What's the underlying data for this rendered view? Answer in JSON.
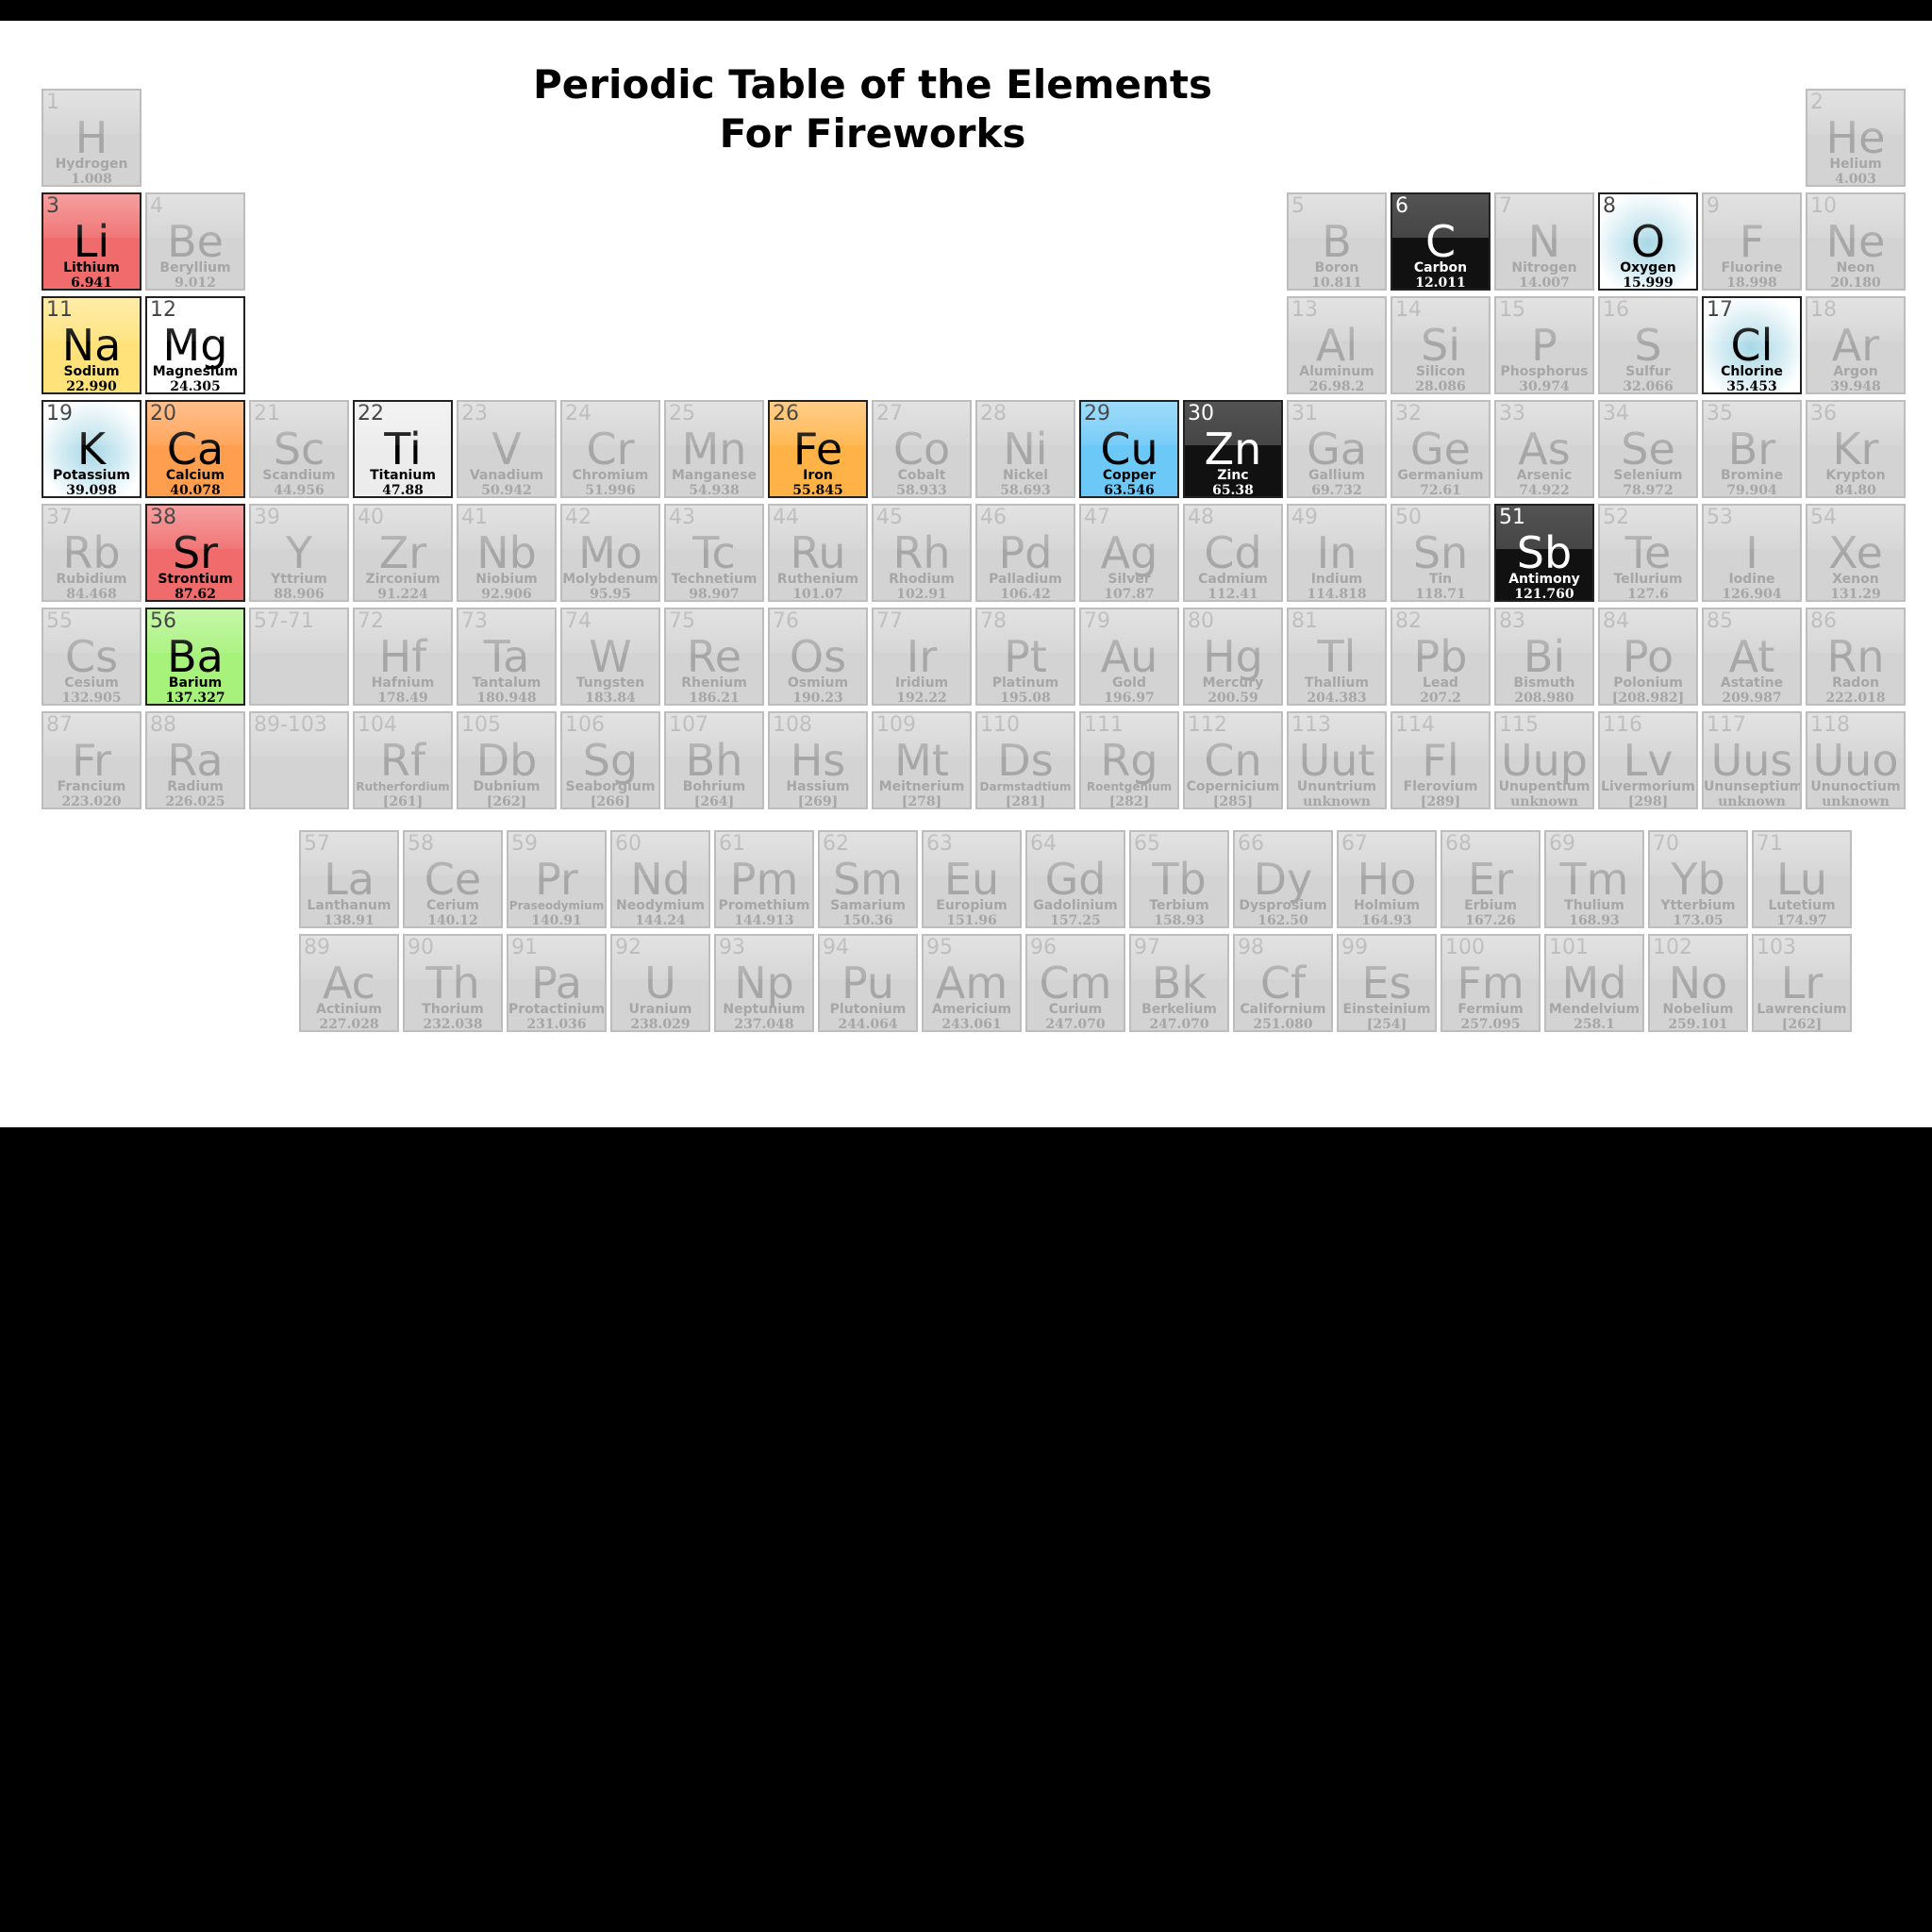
{
  "title": {
    "line1": "Periodic Table of the Elements",
    "line2": "For Fireworks"
  },
  "colors": {
    "inactive_bg": "#d3d3d3",
    "inactive_text": "#a6a6a6"
  },
  "main_table": [
    {
      "n": "1",
      "s": "H",
      "name": "Hydrogen",
      "w": "1.008",
      "row": 1,
      "col": 1
    },
    {
      "n": "2",
      "s": "He",
      "name": "Helium",
      "w": "4.003",
      "row": 1,
      "col": 18
    },
    {
      "n": "3",
      "s": "Li",
      "name": "Lithium",
      "w": "6.941",
      "row": 2,
      "col": 1,
      "color": "#f06b6b",
      "hl": "light"
    },
    {
      "n": "4",
      "s": "Be",
      "name": "Beryllium",
      "w": "9.012",
      "row": 2,
      "col": 2
    },
    {
      "n": "5",
      "s": "B",
      "name": "Boron",
      "w": "10.811",
      "row": 2,
      "col": 13
    },
    {
      "n": "6",
      "s": "C",
      "name": "Carbon",
      "w": "12.011",
      "row": 2,
      "col": 14,
      "color": "#111111",
      "hl": "dark"
    },
    {
      "n": "7",
      "s": "N",
      "name": "Nitrogen",
      "w": "14.007",
      "row": 2,
      "col": 15
    },
    {
      "n": "8",
      "s": "O",
      "name": "Oxygen",
      "w": "15.999",
      "row": 2,
      "col": 16,
      "color": "radial",
      "hl": "light"
    },
    {
      "n": "9",
      "s": "F",
      "name": "Fluorine",
      "w": "18.998",
      "row": 2,
      "col": 17
    },
    {
      "n": "10",
      "s": "Ne",
      "name": "Neon",
      "w": "20.180",
      "row": 2,
      "col": 18
    },
    {
      "n": "11",
      "s": "Na",
      "name": "Sodium",
      "w": "22.990",
      "row": 3,
      "col": 1,
      "color": "#ffe27a",
      "hl": "light"
    },
    {
      "n": "12",
      "s": "Mg",
      "name": "Magnesium",
      "w": "24.305",
      "row": 3,
      "col": 2,
      "color": "#ffffff",
      "hl": "light"
    },
    {
      "n": "13",
      "s": "Al",
      "name": "Aluminum",
      "w": "26.98.2",
      "row": 3,
      "col": 13
    },
    {
      "n": "14",
      "s": "Si",
      "name": "Silicon",
      "w": "28.086",
      "row": 3,
      "col": 14
    },
    {
      "n": "15",
      "s": "P",
      "name": "Phosphorus",
      "w": "30.974",
      "row": 3,
      "col": 15
    },
    {
      "n": "16",
      "s": "S",
      "name": "Sulfur",
      "w": "32.066",
      "row": 3,
      "col": 16
    },
    {
      "n": "17",
      "s": "Cl",
      "name": "Chlorine",
      "w": "35.453",
      "row": 3,
      "col": 17,
      "color": "radial",
      "hl": "light"
    },
    {
      "n": "18",
      "s": "Ar",
      "name": "Argon",
      "w": "39.948",
      "row": 3,
      "col": 18
    },
    {
      "n": "19",
      "s": "K",
      "name": "Potassium",
      "w": "39.098",
      "row": 4,
      "col": 1,
      "color": "radial",
      "hl": "light"
    },
    {
      "n": "20",
      "s": "Ca",
      "name": "Calcium",
      "w": "40.078",
      "row": 4,
      "col": 2,
      "color": "#ff9e4f",
      "hl": "light"
    },
    {
      "n": "21",
      "s": "Sc",
      "name": "Scandium",
      "w": "44.956",
      "row": 4,
      "col": 3
    },
    {
      "n": "22",
      "s": "Ti",
      "name": "Titanium",
      "w": "47.88",
      "row": 4,
      "col": 4,
      "color": "#ececec",
      "hl": "light"
    },
    {
      "n": "23",
      "s": "V",
      "name": "Vanadium",
      "w": "50.942",
      "row": 4,
      "col": 5
    },
    {
      "n": "24",
      "s": "Cr",
      "name": "Chromium",
      "w": "51.996",
      "row": 4,
      "col": 6
    },
    {
      "n": "25",
      "s": "Mn",
      "name": "Manganese",
      "w": "54.938",
      "row": 4,
      "col": 7
    },
    {
      "n": "26",
      "s": "Fe",
      "name": "Iron",
      "w": "55.845",
      "row": 4,
      "col": 8,
      "color": "#ffb347",
      "hl": "light"
    },
    {
      "n": "27",
      "s": "Co",
      "name": "Cobalt",
      "w": "58.933",
      "row": 4,
      "col": 9
    },
    {
      "n": "28",
      "s": "Ni",
      "name": "Nickel",
      "w": "58.693",
      "row": 4,
      "col": 10
    },
    {
      "n": "29",
      "s": "Cu",
      "name": "Copper",
      "w": "63.546",
      "row": 4,
      "col": 11,
      "color": "#6cc8f7",
      "hl": "light"
    },
    {
      "n": "30",
      "s": "Zn",
      "name": "Zinc",
      "w": "65.38",
      "row": 4,
      "col": 12,
      "color": "#111111",
      "hl": "dark"
    },
    {
      "n": "31",
      "s": "Ga",
      "name": "Gallium",
      "w": "69.732",
      "row": 4,
      "col": 13
    },
    {
      "n": "32",
      "s": "Ge",
      "name": "Germanium",
      "w": "72.61",
      "row": 4,
      "col": 14
    },
    {
      "n": "33",
      "s": "As",
      "name": "Arsenic",
      "w": "74.922",
      "row": 4,
      "col": 15
    },
    {
      "n": "34",
      "s": "Se",
      "name": "Selenium",
      "w": "78.972",
      "row": 4,
      "col": 16
    },
    {
      "n": "35",
      "s": "Br",
      "name": "Bromine",
      "w": "79.904",
      "row": 4,
      "col": 17
    },
    {
      "n": "36",
      "s": "Kr",
      "name": "Krypton",
      "w": "84.80",
      "row": 4,
      "col": 18
    },
    {
      "n": "37",
      "s": "Rb",
      "name": "Rubidium",
      "w": "84.468",
      "row": 5,
      "col": 1
    },
    {
      "n": "38",
      "s": "Sr",
      "name": "Strontium",
      "w": "87.62",
      "row": 5,
      "col": 2,
      "color": "#f06b6b",
      "hl": "light"
    },
    {
      "n": "39",
      "s": "Y",
      "name": "Yttrium",
      "w": "88.906",
      "row": 5,
      "col": 3
    },
    {
      "n": "40",
      "s": "Zr",
      "name": "Zirconium",
      "w": "91.224",
      "row": 5,
      "col": 4
    },
    {
      "n": "41",
      "s": "Nb",
      "name": "Niobium",
      "w": "92.906",
      "row": 5,
      "col": 5
    },
    {
      "n": "42",
      "s": "Mo",
      "name": "Molybdenum",
      "w": "95.95",
      "row": 5,
      "col": 6
    },
    {
      "n": "43",
      "s": "Tc",
      "name": "Technetium",
      "w": "98.907",
      "row": 5,
      "col": 7
    },
    {
      "n": "44",
      "s": "Ru",
      "name": "Ruthenium",
      "w": "101.07",
      "row": 5,
      "col": 8
    },
    {
      "n": "45",
      "s": "Rh",
      "name": "Rhodium",
      "w": "102.91",
      "row": 5,
      "col": 9
    },
    {
      "n": "46",
      "s": "Pd",
      "name": "Palladium",
      "w": "106.42",
      "row": 5,
      "col": 10
    },
    {
      "n": "47",
      "s": "Ag",
      "name": "Silver",
      "w": "107.87",
      "row": 5,
      "col": 11
    },
    {
      "n": "48",
      "s": "Cd",
      "name": "Cadmium",
      "w": "112.41",
      "row": 5,
      "col": 12
    },
    {
      "n": "49",
      "s": "In",
      "name": "Indium",
      "w": "114.818",
      "row": 5,
      "col": 13
    },
    {
      "n": "50",
      "s": "Sn",
      "name": "Tin",
      "w": "118.71",
      "row": 5,
      "col": 14
    },
    {
      "n": "51",
      "s": "Sb",
      "name": "Antimony",
      "w": "121.760",
      "row": 5,
      "col": 15,
      "color": "#111111",
      "hl": "dark"
    },
    {
      "n": "52",
      "s": "Te",
      "name": "Tellurium",
      "w": "127.6",
      "row": 5,
      "col": 16
    },
    {
      "n": "53",
      "s": "I",
      "name": "Iodine",
      "w": "126.904",
      "row": 5,
      "col": 17
    },
    {
      "n": "54",
      "s": "Xe",
      "name": "Xenon",
      "w": "131.29",
      "row": 5,
      "col": 18
    },
    {
      "n": "55",
      "s": "Cs",
      "name": "Cesium",
      "w": "132.905",
      "row": 6,
      "col": 1
    },
    {
      "n": "56",
      "s": "Ba",
      "name": "Barium",
      "w": "137.327",
      "row": 6,
      "col": 2,
      "color": "#a6f27a",
      "hl": "light"
    },
    {
      "n": "57-71",
      "s": "",
      "name": "",
      "w": "",
      "row": 6,
      "col": 3
    },
    {
      "n": "72",
      "s": "Hf",
      "name": "Hafnium",
      "w": "178.49",
      "row": 6,
      "col": 4
    },
    {
      "n": "73",
      "s": "Ta",
      "name": "Tantalum",
      "w": "180.948",
      "row": 6,
      "col": 5
    },
    {
      "n": "74",
      "s": "W",
      "name": "Tungsten",
      "w": "183.84",
      "row": 6,
      "col": 6
    },
    {
      "n": "75",
      "s": "Re",
      "name": "Rhenium",
      "w": "186.21",
      "row": 6,
      "col": 7
    },
    {
      "n": "76",
      "s": "Os",
      "name": "Osmium",
      "w": "190.23",
      "row": 6,
      "col": 8
    },
    {
      "n": "77",
      "s": "Ir",
      "name": "Iridium",
      "w": "192.22",
      "row": 6,
      "col": 9
    },
    {
      "n": "78",
      "s": "Pt",
      "name": "Platinum",
      "w": "195.08",
      "row": 6,
      "col": 10
    },
    {
      "n": "79",
      "s": "Au",
      "name": "Gold",
      "w": "196.97",
      "row": 6,
      "col": 11
    },
    {
      "n": "80",
      "s": "Hg",
      "name": "Mercury",
      "w": "200.59",
      "row": 6,
      "col": 12
    },
    {
      "n": "81",
      "s": "Tl",
      "name": "Thallium",
      "w": "204.383",
      "row": 6,
      "col": 13
    },
    {
      "n": "82",
      "s": "Pb",
      "name": "Lead",
      "w": "207.2",
      "row": 6,
      "col": 14
    },
    {
      "n": "83",
      "s": "Bi",
      "name": "Bismuth",
      "w": "208.980",
      "row": 6,
      "col": 15
    },
    {
      "n": "84",
      "s": "Po",
      "name": "Polonium",
      "w": "[208.982]",
      "row": 6,
      "col": 16
    },
    {
      "n": "85",
      "s": "At",
      "name": "Astatine",
      "w": "209.987",
      "row": 6,
      "col": 17
    },
    {
      "n": "86",
      "s": "Rn",
      "name": "Radon",
      "w": "222.018",
      "row": 6,
      "col": 18
    },
    {
      "n": "87",
      "s": "Fr",
      "name": "Francium",
      "w": "223.020",
      "row": 7,
      "col": 1
    },
    {
      "n": "88",
      "s": "Ra",
      "name": "Radium",
      "w": "226.025",
      "row": 7,
      "col": 2
    },
    {
      "n": "89-103",
      "s": "",
      "name": "",
      "w": "",
      "row": 7,
      "col": 3
    },
    {
      "n": "104",
      "s": "Rf",
      "name": "Rutherfordium",
      "w": "[261]",
      "row": 7,
      "col": 4,
      "small": true
    },
    {
      "n": "105",
      "s": "Db",
      "name": "Dubnium",
      "w": "[262]",
      "row": 7,
      "col": 5
    },
    {
      "n": "106",
      "s": "Sg",
      "name": "Seaborgium",
      "w": "[266]",
      "row": 7,
      "col": 6
    },
    {
      "n": "107",
      "s": "Bh",
      "name": "Bohrium",
      "w": "[264]",
      "row": 7,
      "col": 7
    },
    {
      "n": "108",
      "s": "Hs",
      "name": "Hassium",
      "w": "[269]",
      "row": 7,
      "col": 8
    },
    {
      "n": "109",
      "s": "Mt",
      "name": "Meitnerium",
      "w": "[278]",
      "row": 7,
      "col": 9
    },
    {
      "n": "110",
      "s": "Ds",
      "name": "Darmstadtium",
      "w": "[281]",
      "row": 7,
      "col": 10,
      "small": true
    },
    {
      "n": "111",
      "s": "Rg",
      "name": "Roentgenium",
      "w": "[282]",
      "row": 7,
      "col": 11,
      "small": true
    },
    {
      "n": "112",
      "s": "Cn",
      "name": "Copernicium",
      "w": "[285]",
      "row": 7,
      "col": 12
    },
    {
      "n": "113",
      "s": "Uut",
      "name": "Ununtrium",
      "w": "unknown",
      "row": 7,
      "col": 13
    },
    {
      "n": "114",
      "s": "Fl",
      "name": "Flerovium",
      "w": "[289]",
      "row": 7,
      "col": 14
    },
    {
      "n": "115",
      "s": "Uup",
      "name": "Unupentium",
      "w": "unknown",
      "row": 7,
      "col": 15
    },
    {
      "n": "116",
      "s": "Lv",
      "name": "Livermorium",
      "w": "[298]",
      "row": 7,
      "col": 16
    },
    {
      "n": "117",
      "s": "Uus",
      "name": "Ununseptium",
      "w": "unknown",
      "row": 7,
      "col": 17
    },
    {
      "n": "118",
      "s": "Uuo",
      "name": "Ununoctium",
      "w": "unknown",
      "row": 7,
      "col": 18
    }
  ],
  "lanthanides": [
    {
      "n": "57",
      "s": "La",
      "name": "Lanthanum",
      "w": "138.91"
    },
    {
      "n": "58",
      "s": "Ce",
      "name": "Cerium",
      "w": "140.12"
    },
    {
      "n": "59",
      "s": "Pr",
      "name": "Praseodymium",
      "w": "140.91",
      "small": true
    },
    {
      "n": "60",
      "s": "Nd",
      "name": "Neodymium",
      "w": "144.24"
    },
    {
      "n": "61",
      "s": "Pm",
      "name": "Promethium",
      "w": "144.913"
    },
    {
      "n": "62",
      "s": "Sm",
      "name": "Samarium",
      "w": "150.36"
    },
    {
      "n": "63",
      "s": "Eu",
      "name": "Europium",
      "w": "151.96"
    },
    {
      "n": "64",
      "s": "Gd",
      "name": "Gadolinium",
      "w": "157.25"
    },
    {
      "n": "65",
      "s": "Tb",
      "name": "Terbium",
      "w": "158.93"
    },
    {
      "n": "66",
      "s": "Dy",
      "name": "Dysprosium",
      "w": "162.50"
    },
    {
      "n": "67",
      "s": "Ho",
      "name": "Holmium",
      "w": "164.93"
    },
    {
      "n": "68",
      "s": "Er",
      "name": "Erbium",
      "w": "167.26"
    },
    {
      "n": "69",
      "s": "Tm",
      "name": "Thulium",
      "w": "168.93"
    },
    {
      "n": "70",
      "s": "Yb",
      "name": "Ytterbium",
      "w": "173.05"
    },
    {
      "n": "71",
      "s": "Lu",
      "name": "Lutetium",
      "w": "174.97"
    }
  ],
  "actinides": [
    {
      "n": "89",
      "s": "Ac",
      "name": "Actinium",
      "w": "227.028"
    },
    {
      "n": "90",
      "s": "Th",
      "name": "Thorium",
      "w": "232.038"
    },
    {
      "n": "91",
      "s": "Pa",
      "name": "Protactinium",
      "w": "231.036"
    },
    {
      "n": "92",
      "s": "U",
      "name": "Uranium",
      "w": "238.029"
    },
    {
      "n": "93",
      "s": "Np",
      "name": "Neptunium",
      "w": "237.048"
    },
    {
      "n": "94",
      "s": "Pu",
      "name": "Plutonium",
      "w": "244.064"
    },
    {
      "n": "95",
      "s": "Am",
      "name": "Americium",
      "w": "243.061"
    },
    {
      "n": "96",
      "s": "Cm",
      "name": "Curium",
      "w": "247.070"
    },
    {
      "n": "97",
      "s": "Bk",
      "name": "Berkelium",
      "w": "247.070"
    },
    {
      "n": "98",
      "s": "Cf",
      "name": "Californium",
      "w": "251.080"
    },
    {
      "n": "99",
      "s": "Es",
      "name": "Einsteinium",
      "w": "[254]"
    },
    {
      "n": "100",
      "s": "Fm",
      "name": "Fermium",
      "w": "257.095"
    },
    {
      "n": "101",
      "s": "Md",
      "name": "Mendelvium",
      "w": "258.1"
    },
    {
      "n": "102",
      "s": "No",
      "name": "Nobelium",
      "w": "259.101"
    },
    {
      "n": "103",
      "s": "Lr",
      "name": "Lawrencium",
      "w": "[262]"
    }
  ]
}
